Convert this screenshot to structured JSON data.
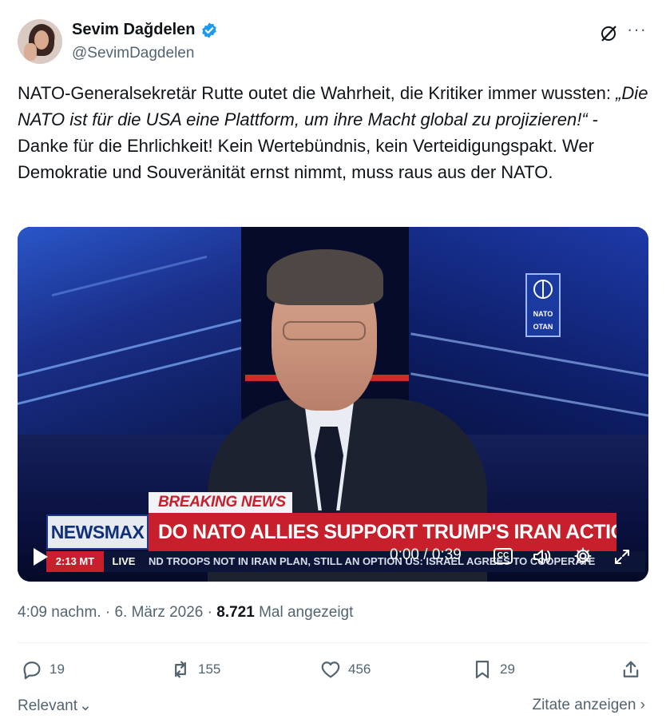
{
  "author": {
    "name": "Sevim Dağdelen",
    "handle": "@SevimDagdelen",
    "verified_icon": "verified-badge-icon",
    "verified_color": "#1d9bf0"
  },
  "tweet": {
    "text_part1": "NATO-Generalsekretär Rutte outet die Wahrheit, die Kritiker immer wussten: ",
    "text_quote": "„Die NATO ist für die USA eine Plattform, um ihre Macht global zu projizieren!“",
    "text_part2": " -Danke für die Ehrlichkeit! Kein Wertebündnis, kein Verteidigungspakt. Wer Demokratie und Souveränität ernst nimmt, muss raus aus der NATO."
  },
  "video": {
    "breaking_label": "BREAKING NEWS",
    "network": "NEWSMAX",
    "headline": "DO NATO ALLIES SUPPORT TRUMP'S IRAN ACTIONS?",
    "ticker_time": "2:13 MT",
    "ticker_live": "LIVE",
    "ticker_text": "ND TROOPS NOT IN IRAN PLAN, STILL AN OPTION   US: ISRAEL AGREES TO COOPERATE",
    "nato_logo_top": "NATO",
    "nato_logo_bottom": "OTAN",
    "current_time": "0:00",
    "separator": "/",
    "duration": "0:39",
    "cc_label": "CC"
  },
  "meta": {
    "time": "4:09 nachm.",
    "dot1": "·",
    "date": "6. März 2026",
    "dot2": "·",
    "views": "8.721",
    "views_label": "Mal angezeigt"
  },
  "actions": {
    "replies": "19",
    "reposts": "155",
    "likes": "456",
    "bookmarks": "29"
  },
  "footer": {
    "relevant": "Relevant",
    "quotes": "Zitate anzeigen"
  }
}
